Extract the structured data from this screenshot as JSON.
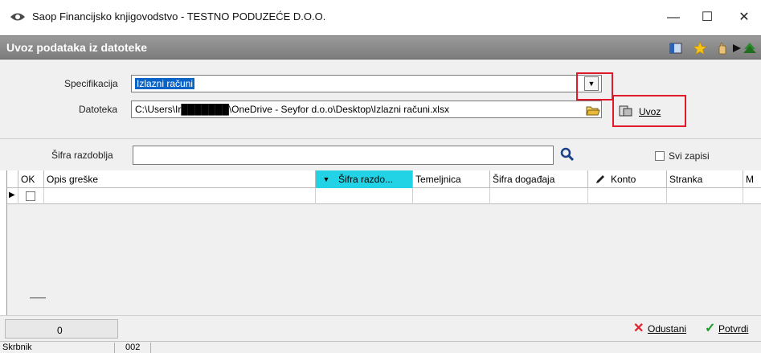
{
  "window": {
    "title": "Saop Financijsko knjigovodstvo - TESTNO PODUZEĆE D.O.O.",
    "minimize_glyph": "—",
    "maximize_glyph": "☐",
    "close_glyph": "✕"
  },
  "header": {
    "title": "Uvoz podataka iz datoteke",
    "toolbar_icons": [
      "layout-icon",
      "star-icon",
      "hand-icon",
      "arrow-right-icon",
      "tree-icon"
    ]
  },
  "form": {
    "specifikacija_label": "Specifikacija",
    "specifikacija_value": "Izlazni računi",
    "datoteka_label": "Datoteka",
    "datoteka_value": "C:\\Users\\Ir███████\\OneDrive - Seyfor d.o.o\\Desktop\\Izlazni računi.xlsx",
    "uvoz_label": "Uvoz"
  },
  "filter": {
    "sifra_razdoblja_label": "Šifra razdoblja",
    "sifra_razdoblja_value": "",
    "svi_zapisi_label": "Svi zapisi"
  },
  "grid": {
    "columns": [
      "OK",
      "Opis greške",
      "Šifra razdo...",
      "Temeljnica",
      "Šifra događaja",
      "Konto",
      "Stranka",
      "M"
    ],
    "row_marker": "▶"
  },
  "footer": {
    "count": "0",
    "odustani_label": "Odustani",
    "potvrdi_label": "Potvrdi"
  },
  "status": {
    "left": "Skrbnik",
    "code": "002"
  },
  "colors": {
    "header_bg": "#8a8a8a",
    "selection": "#0a64c8",
    "highlight_box": "#e01a2a",
    "sort_header": "#22d3e6"
  }
}
